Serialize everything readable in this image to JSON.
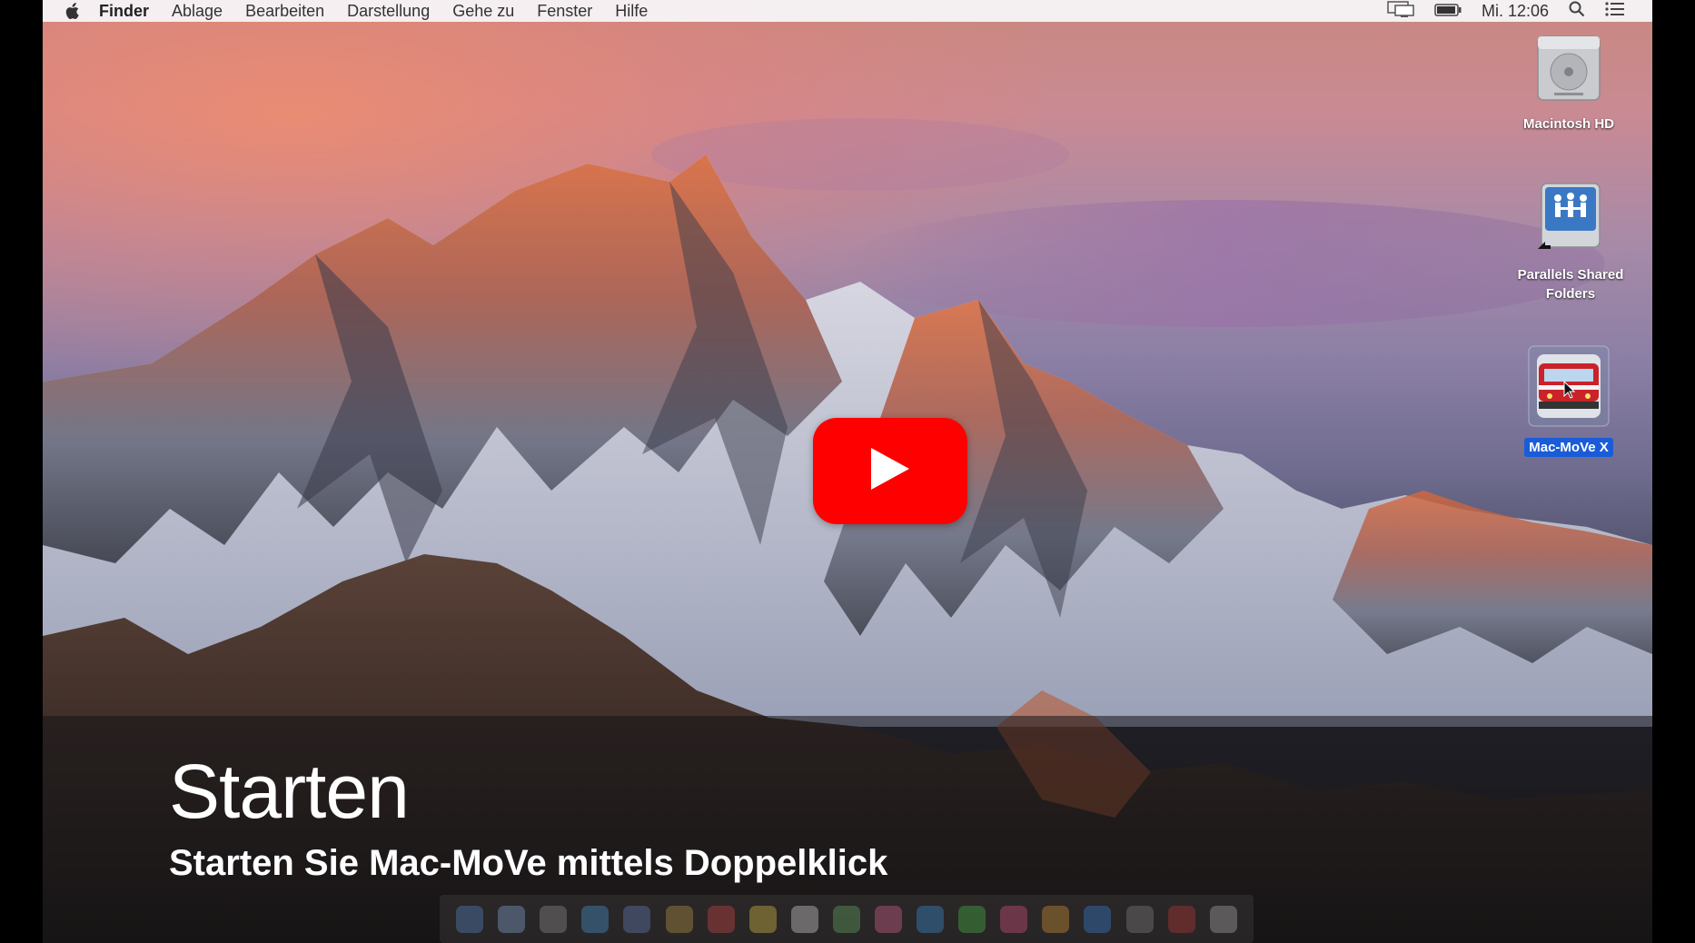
{
  "menubar": {
    "apple_icon": "apple-icon",
    "items": [
      "Finder",
      "Ablage",
      "Bearbeiten",
      "Darstellung",
      "Gehe zu",
      "Fenster",
      "Hilfe"
    ],
    "clock": "Mi. 12:06",
    "status_icons": [
      "display-mirror-icon",
      "battery-icon",
      "spotlight-search-icon",
      "notification-center-icon"
    ]
  },
  "desktop": {
    "icons": [
      {
        "label": "Macintosh HD",
        "icon": "hard-drive-icon"
      },
      {
        "label": "Parallels Shared Folders",
        "icon": "shared-folders-icon"
      },
      {
        "label": "Mac-MoVe X",
        "icon": "mac-move-app-icon",
        "selected": true
      }
    ]
  },
  "video": {
    "play_icon": "youtube-play-icon",
    "title": "Starten",
    "subtitle": "Starten Sie Mac-MoVe mittels Doppelklick"
  },
  "colors": {
    "youtube_red": "#ff0000",
    "selection_blue": "#1a5cd8"
  }
}
